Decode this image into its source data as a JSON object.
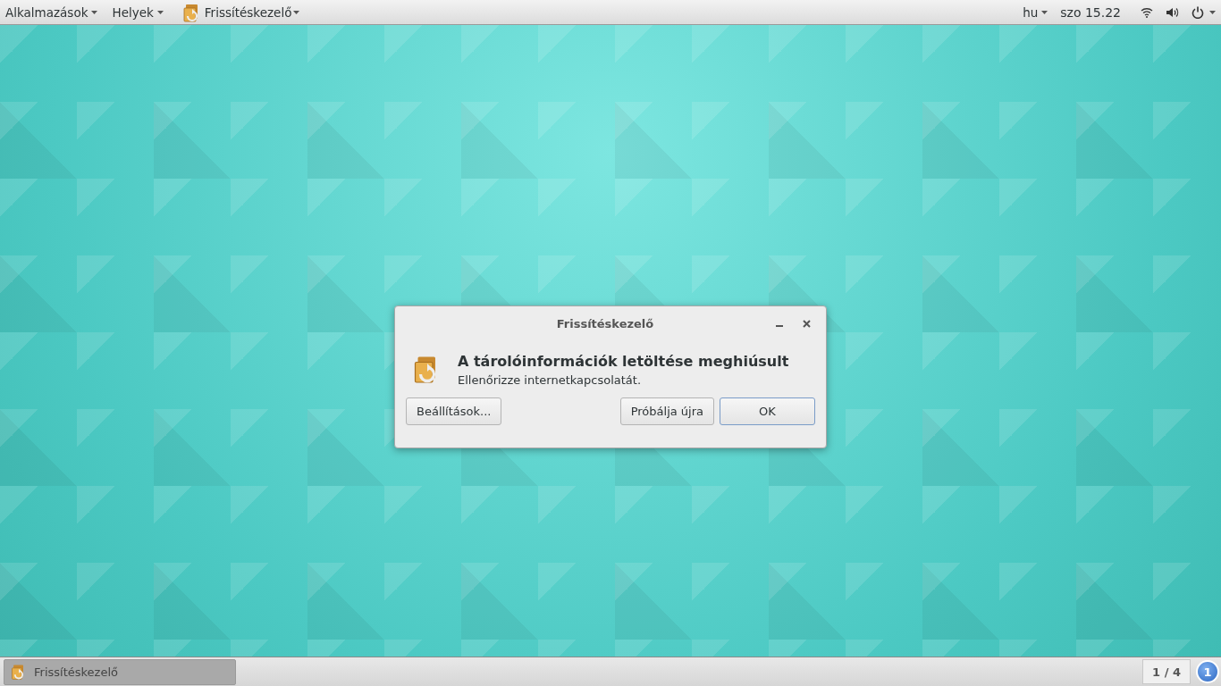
{
  "top_bar": {
    "menus": [
      {
        "label": "Alkalmazások"
      },
      {
        "label": "Helyek"
      }
    ],
    "app_menu": {
      "label": "Frissítéskezelő"
    },
    "keyboard_layout": "hu",
    "clock": "szo 15.22"
  },
  "dialog": {
    "title": "Frissítéskezelő",
    "heading": "A tárolóinformációk letöltése meghiúsult",
    "message": "Ellenőrizze internetkapcsolatát.",
    "buttons": [
      {
        "label": "Beállítások...",
        "default": false
      },
      {
        "label": "Próbálja újra",
        "default": false
      },
      {
        "label": "OK",
        "default": true
      }
    ]
  },
  "bottom_panel": {
    "windows": [
      {
        "label": "Frissítéskezelő",
        "selected": true
      }
    ],
    "workspace": "1 / 4",
    "notification_count": "1"
  }
}
